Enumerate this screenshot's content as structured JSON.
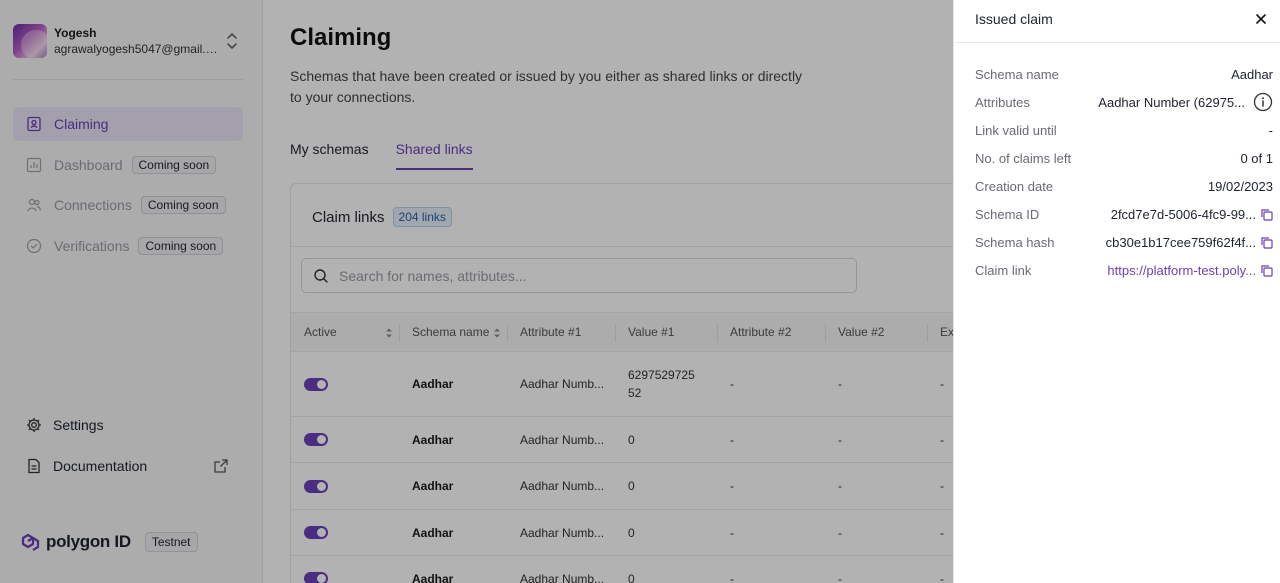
{
  "user": {
    "name": "Yogesh",
    "email": "agrawalyogesh5047@gmail.c..."
  },
  "nav": {
    "items": [
      {
        "label": "Claiming",
        "active": true,
        "badge": ""
      },
      {
        "label": "Dashboard",
        "active": false,
        "badge": "Coming soon"
      },
      {
        "label": "Connections",
        "active": false,
        "badge": "Coming soon"
      },
      {
        "label": "Verifications",
        "active": false,
        "badge": "Coming soon"
      }
    ],
    "bottom": [
      {
        "label": "Settings"
      },
      {
        "label": "Documentation"
      }
    ]
  },
  "brand": {
    "logo_text": "polygon ID",
    "env_badge": "Testnet",
    "accent": "#6b3fb8"
  },
  "page": {
    "title": "Claiming",
    "description": "Schemas that have been created or issued by you either as shared links or directly to your connections.",
    "tabs": [
      {
        "label": "My schemas",
        "active": false
      },
      {
        "label": "Shared links",
        "active": true
      }
    ]
  },
  "card": {
    "title": "Claim links",
    "count_badge": "204 links",
    "search_placeholder": "Search for names, attributes..."
  },
  "table": {
    "columns": [
      "Active",
      "Schema name",
      "Attribute #1",
      "Value #1",
      "Attribute #2",
      "Value #2",
      "Ex"
    ],
    "rows": [
      {
        "active": true,
        "schema": "Aadhar",
        "attr1": "Aadhar Numb...",
        "val1": "6297529725 52",
        "attr2": "-",
        "val2": "-",
        "exp": "-"
      },
      {
        "active": true,
        "schema": "Aadhar",
        "attr1": "Aadhar Numb...",
        "val1": "0",
        "attr2": "-",
        "val2": "-",
        "exp": "-"
      },
      {
        "active": true,
        "schema": "Aadhar",
        "attr1": "Aadhar Numb...",
        "val1": "0",
        "attr2": "-",
        "val2": "-",
        "exp": "-"
      },
      {
        "active": true,
        "schema": "Aadhar",
        "attr1": "Aadhar Numb...",
        "val1": "0",
        "attr2": "-",
        "val2": "-",
        "exp": "-"
      },
      {
        "active": true,
        "schema": "Aadhar",
        "attr1": "Aadhar Numb...",
        "val1": "0",
        "attr2": "-",
        "val2": "-",
        "exp": "-"
      }
    ]
  },
  "drawer": {
    "title": "Issued claim",
    "fields": [
      {
        "label": "Schema name",
        "value": "Aadhar",
        "kind": "text"
      },
      {
        "label": "Attributes",
        "value": "Aadhar Number (62975...",
        "kind": "info"
      },
      {
        "label": "Link valid until",
        "value": "-",
        "kind": "text"
      },
      {
        "label": "No. of claims left",
        "value": "0 of 1",
        "kind": "text"
      },
      {
        "label": "Creation date",
        "value": "19/02/2023",
        "kind": "text"
      },
      {
        "label": "Schema ID",
        "value": "2fcd7e7d-5006-4fc9-99...",
        "kind": "copy"
      },
      {
        "label": "Schema hash",
        "value": "cb30e1b17cee759f62f4f...",
        "kind": "copy"
      },
      {
        "label": "Claim link",
        "value": "https://platform-test.poly...",
        "kind": "link"
      }
    ]
  }
}
